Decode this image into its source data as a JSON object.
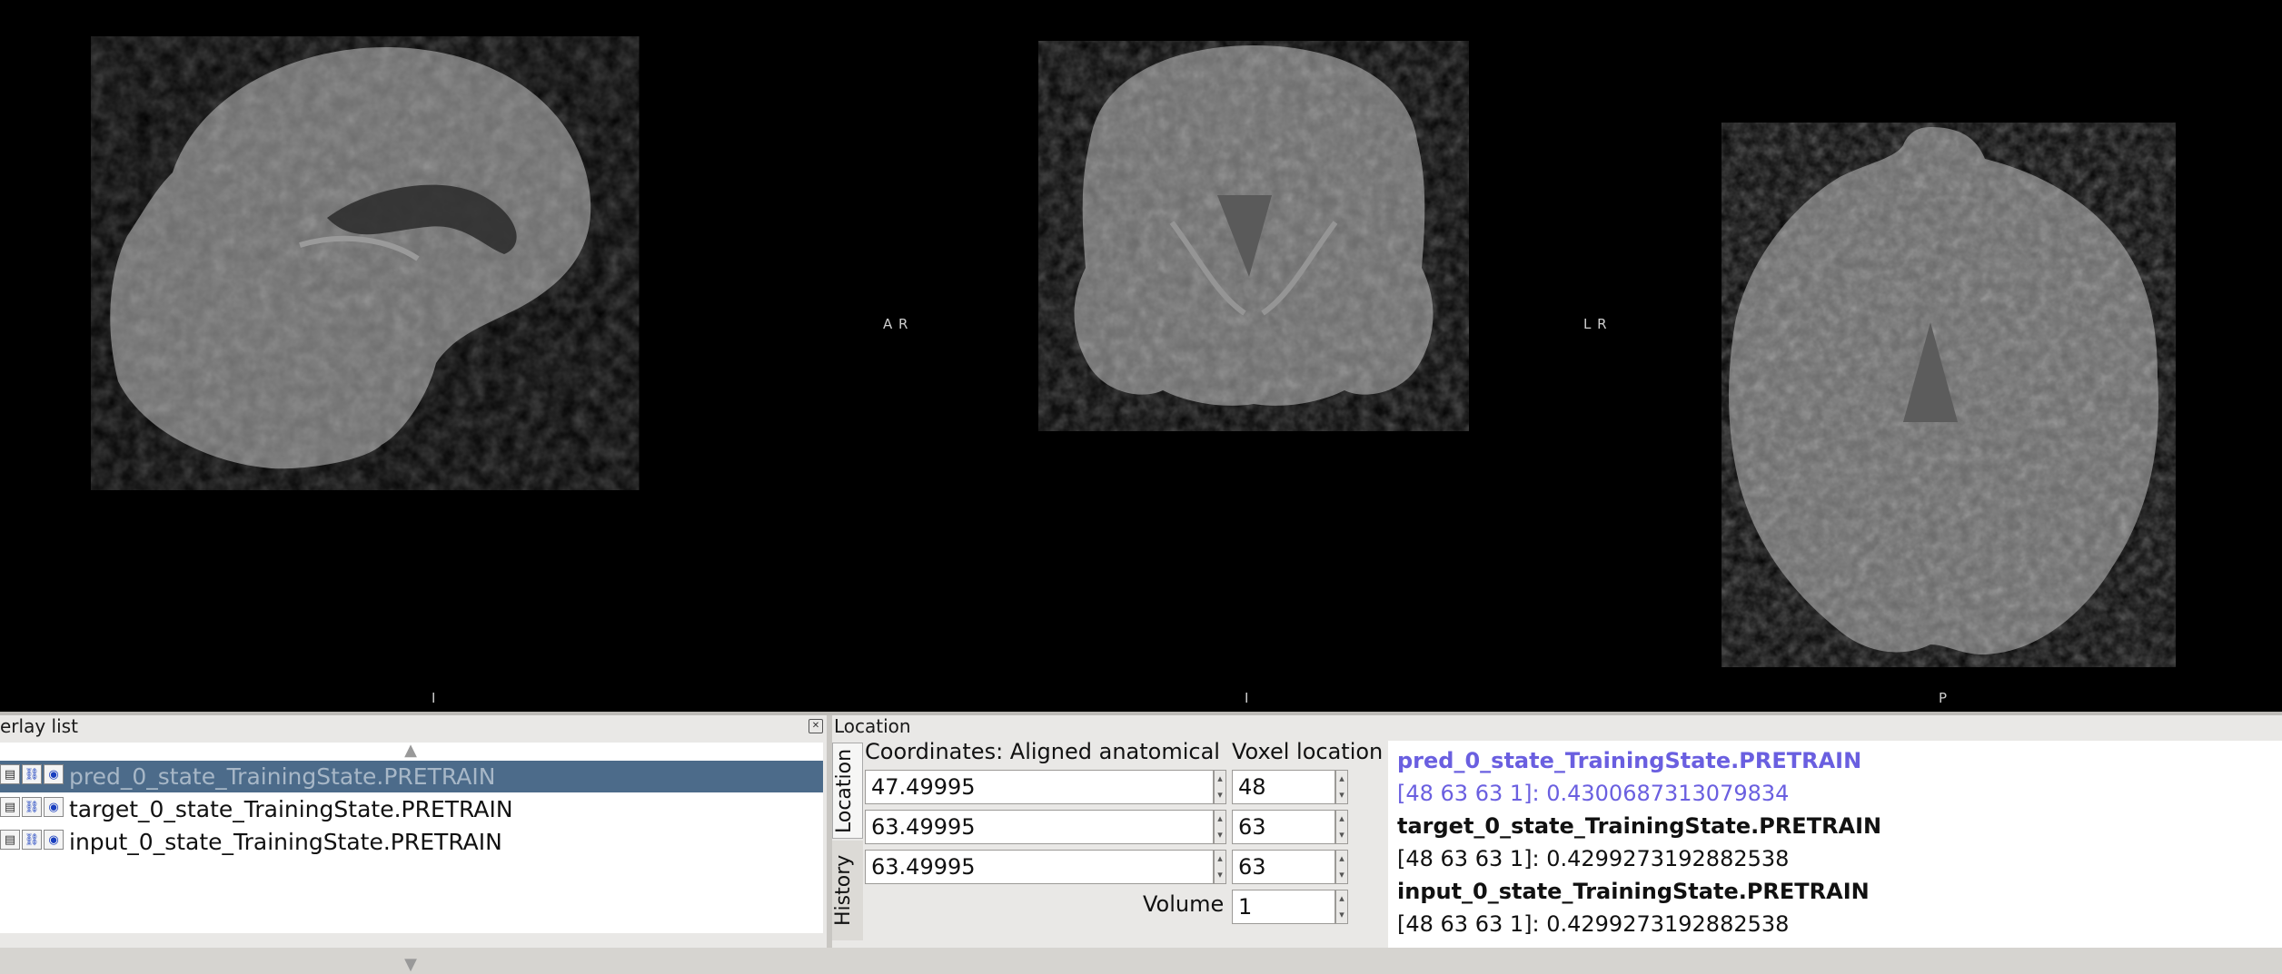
{
  "viewer": {
    "orientation_labels": {
      "sagittal_bottom": "I",
      "coronal_left": "A R",
      "coronal_bottom": "I",
      "axial_left": "L R",
      "axial_bottom": "P"
    }
  },
  "overlay_panel": {
    "title": "erlay list",
    "close_icon": "close-icon",
    "items": [
      {
        "label": "pred_0_state_TrainingState.PRETRAIN",
        "selected": true
      },
      {
        "label": "target_0_state_TrainingState.PRETRAIN",
        "selected": false
      },
      {
        "label": "input_0_state_TrainingState.PRETRAIN",
        "selected": false
      }
    ]
  },
  "location_panel": {
    "title": "Location",
    "tabs": [
      "Location",
      "History"
    ],
    "coordinates_header": "Coordinates: Aligned anatomical",
    "voxel_header": "Voxel location",
    "coords": [
      "47.49995",
      "63.49995",
      "63.49995"
    ],
    "voxels": [
      "48",
      "63",
      "63"
    ],
    "volume_label": "Volume",
    "volume_value": "1",
    "info": [
      {
        "name": "pred_0_state_TrainingState.PRETRAIN",
        "value": "[48 63 63 1]: 0.4300687313079834",
        "color": "#6a5fe0"
      },
      {
        "name": "target_0_state_TrainingState.PRETRAIN",
        "value": "[48 63 63 1]: 0.4299273192882538",
        "color": "#111111"
      },
      {
        "name": "input_0_state_TrainingState.PRETRAIN",
        "value": "[48 63 63 1]: 0.4299273192882538",
        "color": "#111111"
      }
    ]
  }
}
